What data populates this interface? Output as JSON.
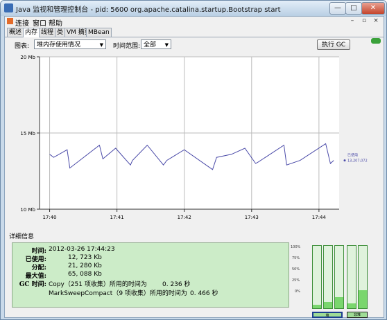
{
  "window": {
    "title": "Java 监视和管理控制台 - pid: 5600 org.apache.catalina.startup.Bootstrap start",
    "minimize_glyph": "—",
    "maximize_glyph": "□",
    "close_glyph": "✕"
  },
  "menubar": {
    "items": [
      "连接",
      "窗口",
      "帮助"
    ],
    "mdi_buttons": [
      "–",
      "▫",
      "×"
    ]
  },
  "tabs": {
    "items": [
      "概述",
      "内存",
      "线程",
      "类",
      "VM 摘要",
      "MBean"
    ],
    "active_index": 1
  },
  "controls": {
    "chart_label": "图表:",
    "chart_value": "堆内存使用情况",
    "range_label": "时间范围:",
    "range_value": "全部",
    "perform_gc_label": "执行 GC"
  },
  "chart_data": {
    "type": "line",
    "ylim": [
      10,
      20
    ],
    "y_unit": "Mb",
    "y_ticks": [
      "10 Mb",
      "15 Mb",
      "20 Mb"
    ],
    "x_ticks": [
      "17:40",
      "17:41",
      "17:42",
      "17:43",
      "17:44"
    ],
    "x_minutes": [
      0,
      1,
      2,
      3,
      4
    ],
    "series": [
      {
        "name": "已使用",
        "color": "#4a4aa8",
        "x": [
          0,
          0.06,
          0.26,
          0.3,
          0.74,
          0.79,
          0.98,
          1.2,
          1.23,
          1.45,
          1.69,
          1.74,
          2.0,
          2.42,
          2.48,
          2.7,
          2.9,
          3.06,
          3.1,
          3.48,
          3.52,
          3.72,
          4.1,
          4.17,
          4.22
        ],
        "values": [
          13.6,
          13.4,
          13.9,
          12.7,
          14.2,
          13.3,
          14.0,
          12.9,
          13.2,
          14.2,
          12.9,
          13.2,
          13.9,
          12.6,
          13.4,
          13.6,
          14.0,
          13.0,
          13.1,
          14.2,
          12.9,
          13.2,
          14.3,
          13.0,
          13.2
        ]
      }
    ],
    "current_label": "已使用",
    "current_value": "13,207,072"
  },
  "details": {
    "header": "详细信息",
    "rows": [
      {
        "label": "时间:",
        "value": "2012-03-26 17:44:23"
      },
      {
        "label": "已使用:",
        "value": "12, 723 Kb"
      },
      {
        "label": "分配:",
        "value": "21, 280 Kb"
      },
      {
        "label": "最大值:",
        "value": "65, 088 Kb"
      }
    ],
    "gc_label": "GC 时间:",
    "gc_rows": [
      {
        "name": "Copy（251 项收集）所用的时间为",
        "value": "0. 236 秒"
      },
      {
        "name": "MarkSweepCompact（9 项收集）所用的时间为",
        "value": "0. 466 秒"
      }
    ]
  },
  "memory_pools": {
    "y_ticks": [
      "100%",
      "75%",
      "50%",
      "25%",
      "0%"
    ],
    "bar_fill_fractions": [
      0.06,
      0.1,
      0.18,
      0.08,
      0.29
    ],
    "buttons": [
      "堆",
      "非堆"
    ],
    "selected_button": 0
  },
  "colors": {
    "series_line": "#4a4aa8",
    "details_bg": "#ccecc8",
    "bar_fill": "#7ad66e"
  }
}
